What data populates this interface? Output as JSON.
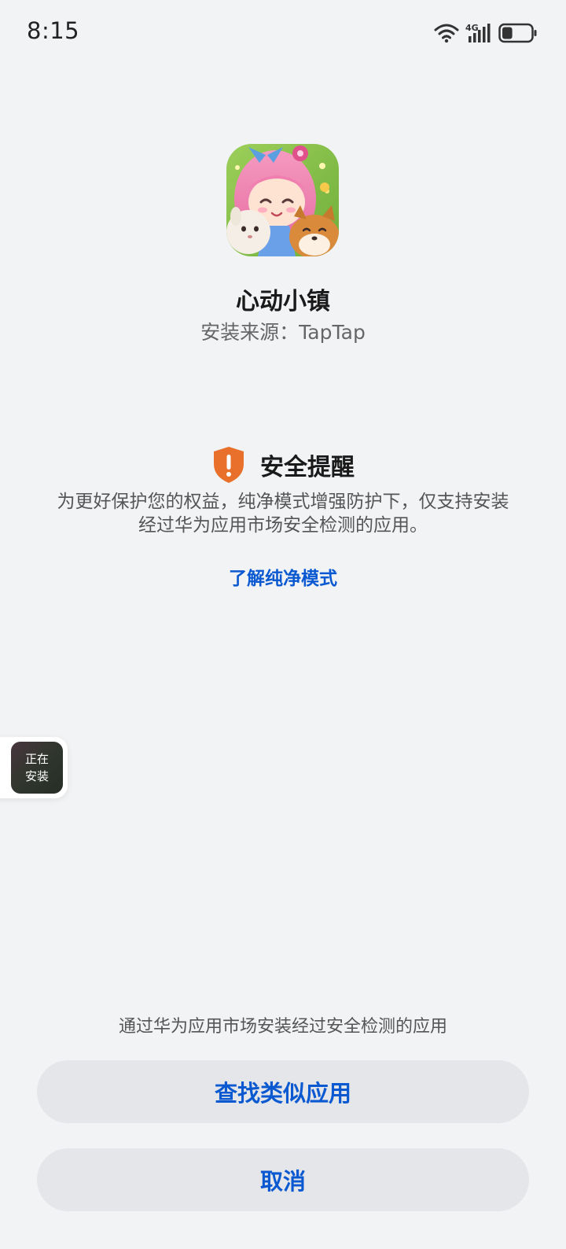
{
  "status_bar": {
    "time": "8:15",
    "network_label": "4G",
    "battery_level": 0.35
  },
  "app": {
    "name": "心动小镇",
    "source": "安装来源：TapTap"
  },
  "warning": {
    "icon": "shield-exclamation-icon",
    "title": "安全提醒",
    "line1": "为更好保护您的权益，纯净模式增强防护下，仅支持安装",
    "line2": "经过华为应用市场安全检测的应用。",
    "link": "了解纯净模式"
  },
  "floating": {
    "line1": "正在",
    "line2": "安装"
  },
  "hint": "通过华为应用市场安装经过安全检测的应用",
  "buttons": {
    "find_similar": "查找类似应用",
    "cancel": "取消"
  },
  "colors": {
    "accent": "#0a59d1",
    "warning": "#e8702a",
    "background": "#f1f3f5",
    "button_bg": "#e4e6e9"
  }
}
